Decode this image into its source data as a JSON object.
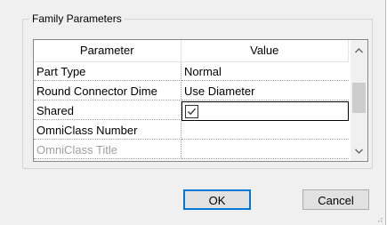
{
  "group": {
    "title": "Family Parameters"
  },
  "grid": {
    "columns": [
      "Parameter",
      "Value"
    ],
    "rows": [
      {
        "parameter": "Part Type",
        "value": "Normal",
        "type": "text",
        "disabled": false
      },
      {
        "parameter": "Round Connector Dime",
        "value": "Use Diameter",
        "type": "text",
        "disabled": false
      },
      {
        "parameter": "Shared",
        "value": "",
        "type": "checkbox",
        "checked": true,
        "disabled": false
      },
      {
        "parameter": "OmniClass Number",
        "value": "",
        "type": "text",
        "disabled": false
      },
      {
        "parameter": "OmniClass Title",
        "value": "",
        "type": "text",
        "disabled": true
      }
    ]
  },
  "buttons": {
    "ok": "OK",
    "cancel": "Cancel"
  },
  "icons": {
    "scroll_up": "chevron-up-icon",
    "scroll_down": "chevron-down-icon",
    "checkmark": "checkmark-icon",
    "resize_grip": "resize-grip-icon"
  },
  "colors": {
    "default_button_border": "#0078d7",
    "disabled_text": "#a0a0a0"
  }
}
